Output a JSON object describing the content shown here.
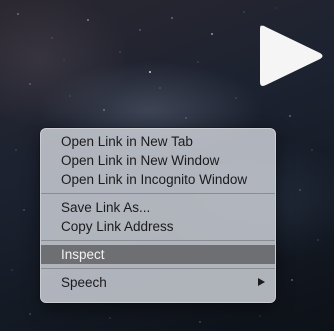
{
  "context_menu": {
    "group1": [
      {
        "label": "Open Link in New Tab"
      },
      {
        "label": "Open Link in New Window"
      },
      {
        "label": "Open Link in Incognito Window"
      }
    ],
    "group2": [
      {
        "label": "Save Link As..."
      },
      {
        "label": "Copy Link Address"
      }
    ],
    "group3": [
      {
        "label": "Inspect",
        "highlighted": true
      }
    ],
    "group4": [
      {
        "label": "Speech",
        "has_submenu": true
      }
    ]
  },
  "icons": {
    "play": "play-icon",
    "submenu": "chevron-right-icon"
  },
  "colors": {
    "menu_background": "#c9cdd4",
    "highlight": "#6e6f73",
    "menu_text": "#1b1b1d",
    "play_button": "#f5f5f5"
  }
}
